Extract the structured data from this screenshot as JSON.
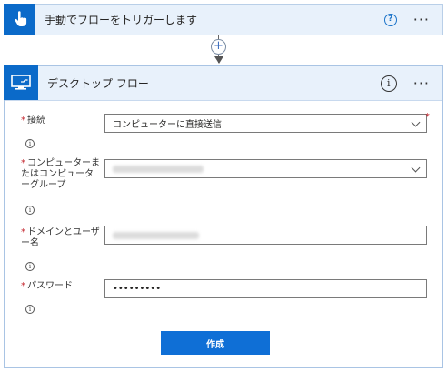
{
  "trigger": {
    "title": "手動でフローをトリガーします",
    "icon": "touch-hand-icon",
    "help_glyph": "?",
    "more_glyph": "···"
  },
  "connector": {
    "add_glyph": "+"
  },
  "action": {
    "title": "デスクトップ フロー",
    "icon": "desktop-flow-icon",
    "info_glyph": "i",
    "more_glyph": "···",
    "fields": {
      "connection": {
        "label": "接続",
        "value": "コンピューターに直接送信",
        "required": "*"
      },
      "machine": {
        "label": "コンピューターまたはコンピューターグループ",
        "required": "*"
      },
      "domain_user": {
        "label": "ドメインとユーザー名",
        "required": "*"
      },
      "password": {
        "label": "パスワード",
        "value": "•••••••••",
        "required": "*"
      }
    },
    "info_small_glyph": "i",
    "create_label": "作成"
  },
  "colors": {
    "accent": "#0f6fd6",
    "header_bg": "#e8f1fb",
    "required": "#c4262e"
  }
}
